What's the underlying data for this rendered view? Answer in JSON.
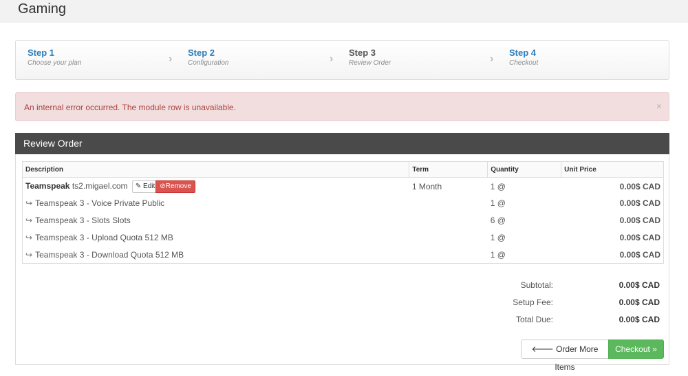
{
  "header": {
    "title": "Gaming"
  },
  "steps": [
    {
      "num": "Step 1",
      "label": "Choose your plan",
      "active": false
    },
    {
      "num": "Step 2",
      "label": "Configuration",
      "active": false
    },
    {
      "num": "Step 3",
      "label": "Review Order",
      "active": true
    },
    {
      "num": "Step 4",
      "label": "Checkout",
      "active": false
    }
  ],
  "alert": {
    "message": "An internal error occurred. The module row is unavailable.",
    "close": "×"
  },
  "panel": {
    "title": "Review Order"
  },
  "table": {
    "headers": [
      "Description",
      "Term",
      "Quantity",
      "Unit Price"
    ],
    "package": {
      "name": "Teamspeak",
      "host": "ts2.migael.com",
      "term": "1 Month",
      "qty": "1 @",
      "price": "0.00$ CAD",
      "edit": "Edit",
      "remove": "Remove"
    },
    "options": [
      {
        "desc": "Teamspeak 3 - Voice Private Public",
        "qty": "1 @",
        "price": "0.00$ CAD"
      },
      {
        "desc": "Teamspeak 3 - Slots Slots",
        "qty": "6 @",
        "price": "0.00$ CAD"
      },
      {
        "desc": "Teamspeak 3 - Upload Quota 512 MB",
        "qty": "1 @",
        "price": "0.00$ CAD"
      },
      {
        "desc": "Teamspeak 3 - Download Quota 512 MB",
        "qty": "1 @",
        "price": "0.00$ CAD"
      }
    ]
  },
  "totals": [
    {
      "label": "Subtotal:",
      "value": "0.00$ CAD"
    },
    {
      "label": "Setup Fee:",
      "value": "0.00$ CAD"
    },
    {
      "label": "Total Due:",
      "value": "0.00$ CAD"
    }
  ],
  "actions": {
    "more": "Order More Items",
    "checkout": "Checkout"
  }
}
